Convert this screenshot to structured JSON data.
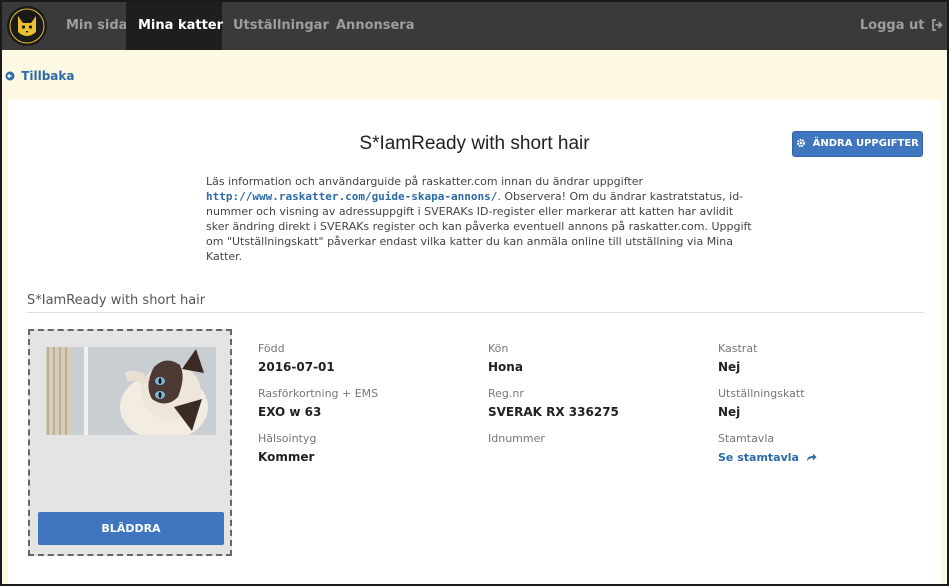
{
  "nav": {
    "items": [
      {
        "label": "Min sida",
        "active": false
      },
      {
        "label": "Mina katter",
        "active": true
      },
      {
        "label": "Utställningar",
        "active": false
      },
      {
        "label": "Annonsera",
        "active": false
      }
    ],
    "logout_label": "Logga ut"
  },
  "back": {
    "label": "Tillbaka"
  },
  "page": {
    "title": "S*IamReady with short hair",
    "edit_button": "ÄNDRA UPPGIFTER",
    "info_before_link": "Läs information och användarguide på raskatter.com innan du ändrar uppgifter",
    "info_link": "http://www.raskatter.com/guide-skapa-annons/",
    "info_after_link": ". Observera! Om du ändrar kastratstatus, id-nummer och visning av adressuppgift i SVERAKs ID-register eller markerar att katten har avlidit sker ändring direkt i SVERAKs register och kan påverka eventuell annons på raskatter.com. Uppgift om \"Utställningskatt\" påverkar endast vilka katter du kan anmäla online till utställning via Mina Katter.",
    "section_title": "S*IamReady with short hair"
  },
  "image_box": {
    "browse_label": "BLÄDDRA"
  },
  "fields": {
    "born": {
      "label": "Född",
      "value": "2016-07-01"
    },
    "sex": {
      "label": "Kön",
      "value": "Hona"
    },
    "neutered": {
      "label": "Kastrat",
      "value": "Nej"
    },
    "breed": {
      "label": "Rasförkortning + EMS",
      "value": "EXO w 63"
    },
    "regnr": {
      "label": "Reg.nr",
      "value": "SVERAK RX 336275"
    },
    "showcat": {
      "label": "Utställningskatt",
      "value": "Nej"
    },
    "health": {
      "label": "Hälsointyg",
      "value": "Kommer"
    },
    "idnr": {
      "label": "Idnummer",
      "value": ""
    },
    "pedigree": {
      "label": "Stamtavla",
      "link": "Se stamtavla"
    }
  },
  "colors": {
    "navbar": "#3a3a3a",
    "nav_active": "#1e1e1e",
    "accent": "#3f76bf",
    "back_bg": "#fcf8e3",
    "link": "#2c6aa8"
  }
}
